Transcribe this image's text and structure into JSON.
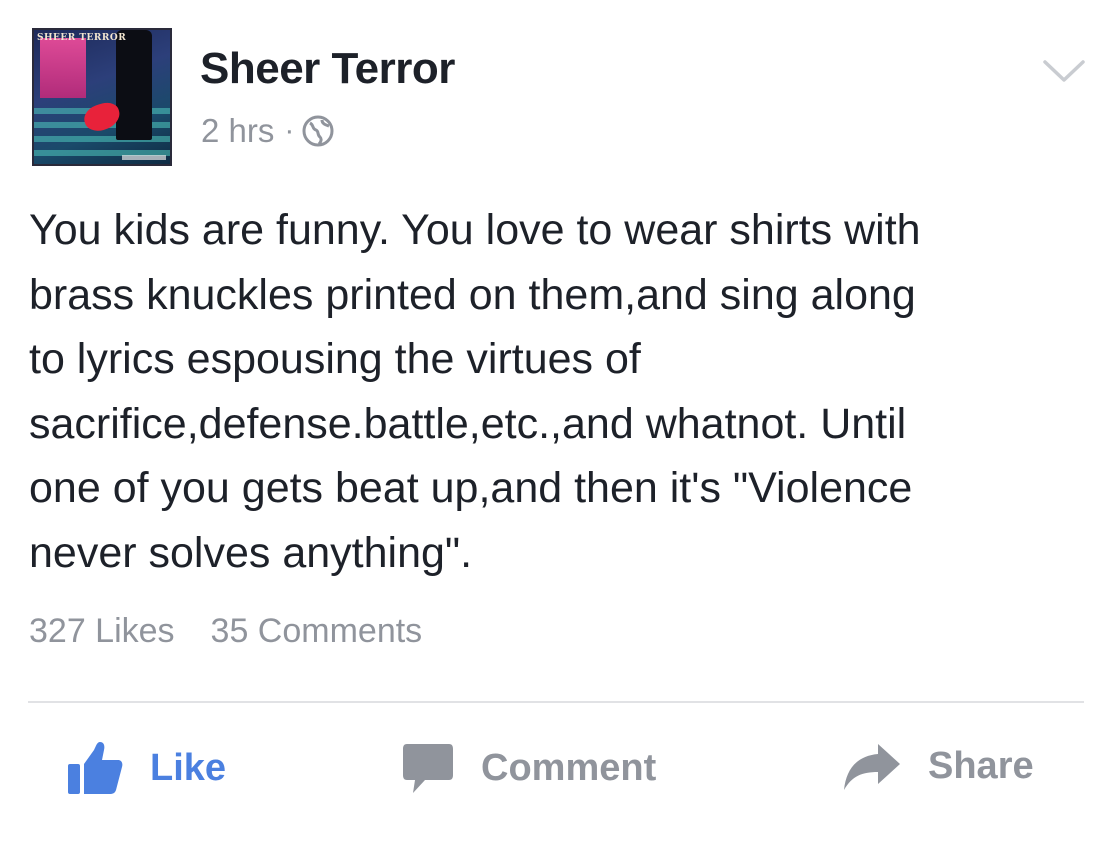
{
  "post": {
    "page_name": "Sheer Terror",
    "timestamp": "2 hrs",
    "separator": "·",
    "privacy_icon": "globe-icon",
    "avatar_banner": "SHEER TERROR",
    "text": "You kids are funny. You love to wear shirts with\nbrass knuckles printed on them,and sing along\nto lyrics espousing the virtues of\nsacrifice,defense.battle,etc.,and whatnot. Until\none of you gets beat up,and then it's \"Violence\nnever solves anything\".",
    "likes_count": "327 Likes",
    "comments_count": "35 Comments"
  },
  "actions": {
    "like_label": "Like",
    "comment_label": "Comment",
    "share_label": "Share"
  },
  "colors": {
    "accent_blue": "#4b80e0",
    "muted_gray": "#90949c",
    "text_dark": "#1d2129",
    "divider": "#e1e2e5"
  },
  "icons": [
    "thumbs-up-icon",
    "speech-bubble-icon",
    "share-arrow-icon",
    "chevron-down-icon",
    "globe-icon"
  ]
}
